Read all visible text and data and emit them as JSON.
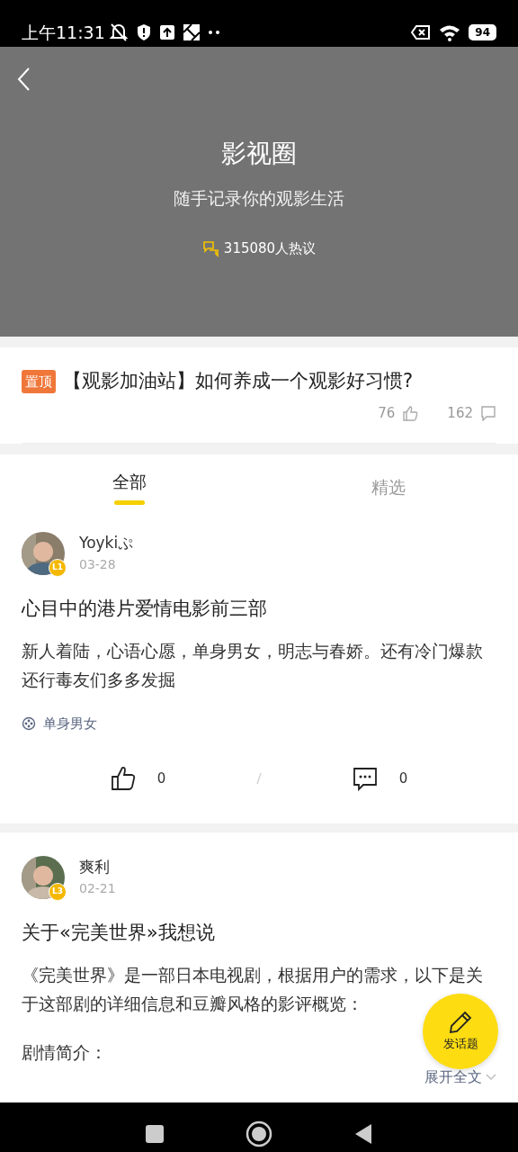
{
  "status_bar": {
    "time": "上午11:31",
    "battery": "94"
  },
  "header": {
    "title": "影视圈",
    "subtitle": "随手记录你的观影生活",
    "discussion_count": "315080人热议"
  },
  "pinned_post": {
    "badge": "置顶",
    "title": "【观影加油站】如何养成一个观影好习惯?",
    "likes": "76",
    "comments": "162"
  },
  "tabs": [
    {
      "label": "全部",
      "selected": true
    },
    {
      "label": "精选",
      "selected": false
    }
  ],
  "posts": [
    {
      "author": "Yoykiぷ",
      "level": "L1",
      "date": "03-28",
      "title": "心目中的港片爱情电影前三部",
      "body": "新人着陆，心语心愿，单身男女，明志与春娇。还有冷门爆款还行毒友们多多发掘",
      "tag": "单身男女",
      "likes": "0",
      "comments": "0"
    },
    {
      "author": "爽利",
      "level": "L3",
      "date": "02-21",
      "title": "关于«完美世界»我想说",
      "body": "《完美世界》是一部日本电视剧，根据用户的需求，以下是关于这部剧的详细信息和豆瓣风格的影评概览：",
      "body_2": "剧情简介：",
      "expand_link": "展开全文"
    }
  ],
  "fab": {
    "label": "发话题"
  }
}
